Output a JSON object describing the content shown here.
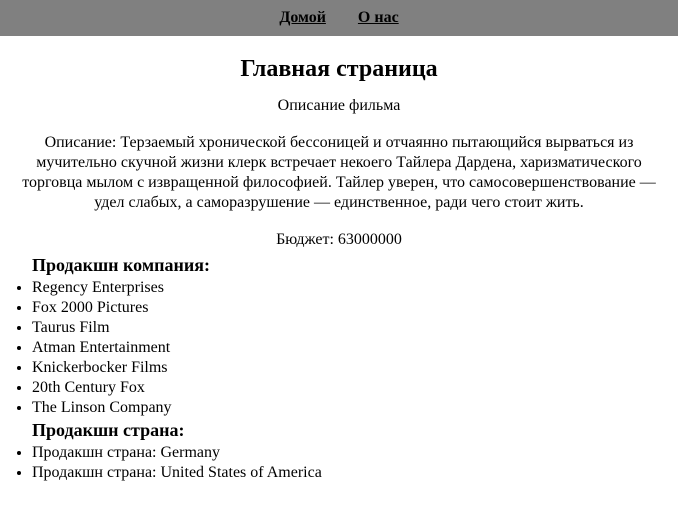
{
  "nav": {
    "home": "Домой",
    "about": "О нас"
  },
  "page": {
    "title": "Главная страница",
    "subtitle": "Описание фильма"
  },
  "movie": {
    "description_label": "Описание: ",
    "description": "Терзаемый хронической бессоницей и отчаянно пытающийся вырваться из мучительно скучной жизни клерк встречает некоего Тайлера Дардена, харизматического торговца мылом с извращенной философией. Тайлер уверен, что самосовершенствование — удел слабых, а саморазрушение — единственное, ради чего стоит жить.",
    "budget_label": "Бюджет: ",
    "budget": "63000000"
  },
  "sections": {
    "production_companies_heading": "Продакшн компания:",
    "production_companies": [
      "Regency Enterprises",
      "Fox 2000 Pictures",
      "Taurus Film",
      "Atman Entertainment",
      "Knickerbocker Films",
      "20th Century Fox",
      "The Linson Company"
    ],
    "production_countries_heading": "Продакшн страна:",
    "production_country_label": "Продакшн страна: ",
    "production_countries": [
      "Germany",
      "United States of America"
    ]
  }
}
